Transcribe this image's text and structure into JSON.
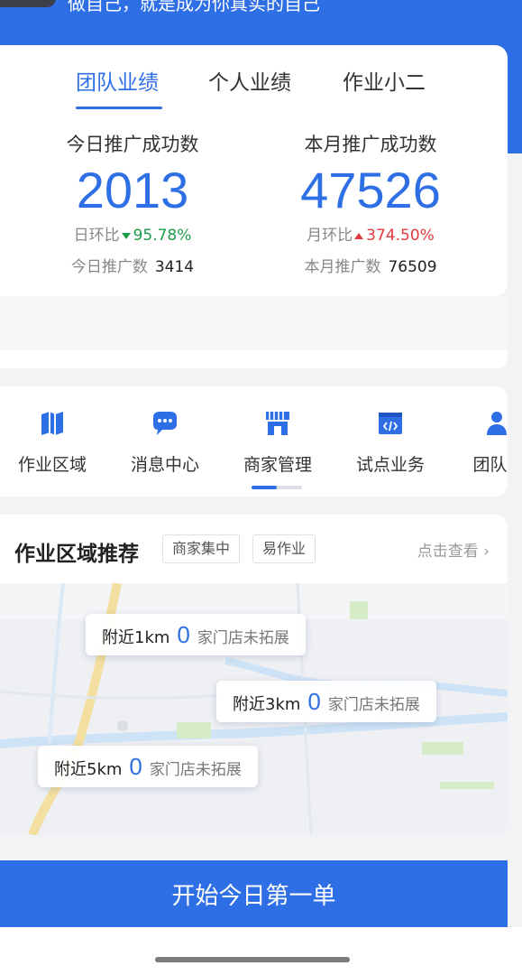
{
  "header": {
    "slogan": "做自己，就是成为你真实的自己"
  },
  "performance": {
    "tabs": [
      {
        "label": "团队业绩",
        "active": true
      },
      {
        "label": "个人业绩",
        "active": false
      },
      {
        "label": "作业小二",
        "active": false
      }
    ],
    "today": {
      "label": "今日推广成功数",
      "value": "2013",
      "ratio_label": "日环比",
      "ratio_value": "95.78%",
      "ratio_direction": "down",
      "total_label": "今日推广数",
      "total_value": "3414"
    },
    "month": {
      "label": "本月推广成功数",
      "value": "47526",
      "ratio_label": "月环比",
      "ratio_value": "374.50%",
      "ratio_direction": "up",
      "total_label": "本月推广数",
      "total_value": "76509"
    }
  },
  "menu": {
    "items": [
      {
        "label": "作业区域",
        "icon": "map-book-icon"
      },
      {
        "label": "消息中心",
        "icon": "chat-bubble-icon"
      },
      {
        "label": "商家管理",
        "icon": "storefront-icon"
      },
      {
        "label": "试点业务",
        "icon": "code-window-icon"
      },
      {
        "label": "团队管",
        "icon": "team-icon"
      }
    ]
  },
  "area": {
    "title": "作业区域推荐",
    "tags": [
      "商家集中",
      "易作业"
    ],
    "view_link": "点击查看",
    "pills": [
      {
        "distance": "附近1km",
        "count": "0",
        "note": "家门店未拓展"
      },
      {
        "distance": "附近3km",
        "count": "0",
        "note": "家门店未拓展"
      },
      {
        "distance": "附近5km",
        "count": "0",
        "note": "家门店未拓展"
      }
    ]
  },
  "cta": {
    "label": "开始今日第一单"
  },
  "colors": {
    "brand": "#2f6fe6",
    "down": "#1e9b4a",
    "up": "#e0393e"
  }
}
